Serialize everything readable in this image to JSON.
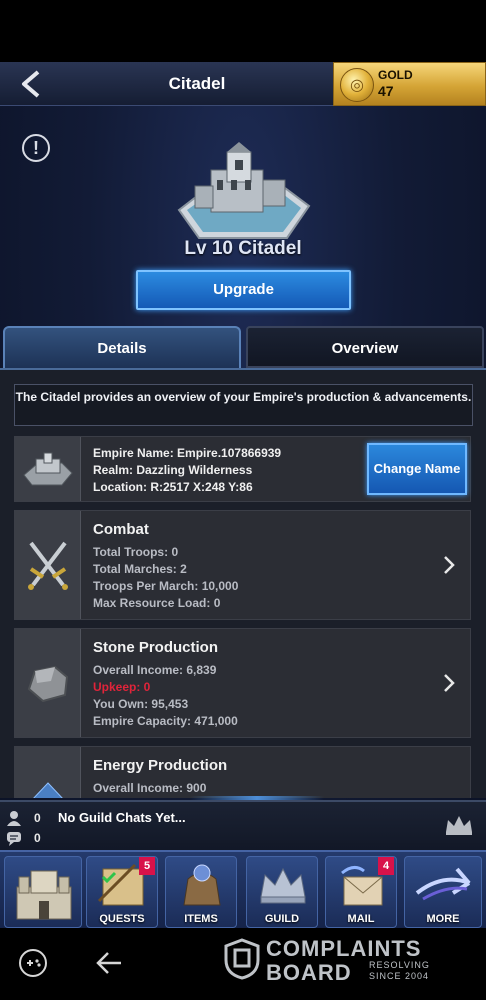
{
  "header": {
    "title": "Citadel",
    "gold_label": "GOLD",
    "gold_value": "47"
  },
  "building": {
    "level_title": "Lv 10 Citadel",
    "upgrade_label": "Upgrade"
  },
  "tabs": [
    {
      "label": "Details",
      "active": true
    },
    {
      "label": "Overview",
      "active": false
    }
  ],
  "description": "The Citadel provides an overview of your Empire's production & advancements.",
  "empire": {
    "name_line": "Empire Name: Empire.107866939",
    "realm_line": "Realm: Dazzling Wilderness",
    "location_line": "Location: R:2517 X:248 Y:86",
    "change_name_label": "Change Name"
  },
  "combat": {
    "title": "Combat",
    "lines": [
      "Total Troops: 0",
      "Total Marches: 2",
      "Troops Per March: 10,000",
      "Max Resource Load: 0"
    ]
  },
  "stone": {
    "title": "Stone Production",
    "income": "Overall Income: 6,839",
    "upkeep": "Upkeep: 0",
    "own": "You Own: 95,453",
    "capacity": "Empire Capacity: 471,000"
  },
  "energy": {
    "title": "Energy Production",
    "income": "Overall Income: 900"
  },
  "chat": {
    "members_count": "0",
    "messages_count": "0",
    "text": "No Guild Chats Yet..."
  },
  "nav": [
    {
      "label": "",
      "badge": ""
    },
    {
      "label": "QUESTS",
      "badge": "5"
    },
    {
      "label": "ITEMS",
      "badge": ""
    },
    {
      "label": "GUILD",
      "badge": ""
    },
    {
      "label": "MAIL",
      "badge": "4"
    },
    {
      "label": "MORE",
      "badge": ""
    }
  ],
  "watermark": {
    "line1": "COMPLAINTS",
    "line2": "BOARD",
    "tagline1": "RESOLVING",
    "tagline2": "SINCE 2004"
  },
  "colors": {
    "accent_blue": "#1f6fd0",
    "gold": "#e2b23a",
    "upkeep_red": "#e0243a",
    "badge_red": "#d8124a"
  }
}
